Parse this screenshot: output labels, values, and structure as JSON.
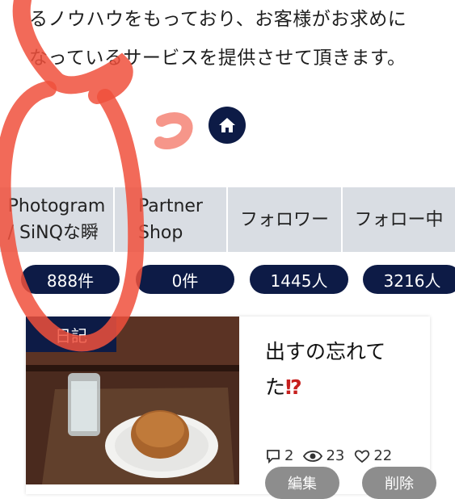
{
  "intro": {
    "line1": "るノウハウをもっており、お客様がお求めに",
    "line2": "なっているサービスを提供させて頂きます。"
  },
  "home": {
    "icon": "home-icon"
  },
  "stats": [
    {
      "label": "Photogram\n/ SiNQな瞬",
      "count": "888件"
    },
    {
      "label": "Partner\nShop",
      "count": "0件"
    },
    {
      "label": "フォロワー",
      "count": "1445人"
    },
    {
      "label": "フォロー中",
      "count": "3216人"
    }
  ],
  "post": {
    "tag": "日記",
    "title": "出すの忘れてた",
    "title_emphasis": "⁉",
    "comments": "2",
    "views": "23",
    "likes": "22",
    "edit_label": "編集",
    "delete_label": "削除"
  },
  "colors": {
    "navy": "#0d1b46",
    "stat_bg": "#d9dde3",
    "button_gray": "#8d8d8d",
    "scribble": "#f0503c"
  }
}
